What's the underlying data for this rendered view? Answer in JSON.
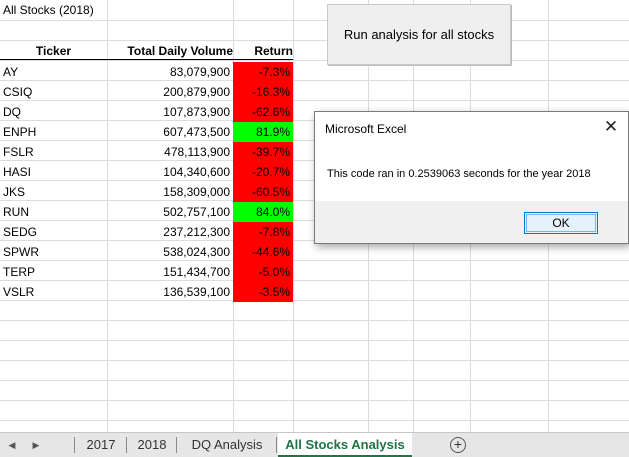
{
  "sheet_title": "All Stocks (2018)",
  "columns": {
    "ticker": "Ticker",
    "volume": "Total Daily Volume",
    "return": "Return"
  },
  "rows": [
    {
      "ticker": "AY",
      "volume": "83,079,900",
      "return": "-7.3%",
      "status": "negative"
    },
    {
      "ticker": "CSIQ",
      "volume": "200,879,900",
      "return": "-16.3%",
      "status": "negative"
    },
    {
      "ticker": "DQ",
      "volume": "107,873,900",
      "return": "-62.6%",
      "status": "negative"
    },
    {
      "ticker": "ENPH",
      "volume": "607,473,500",
      "return": "81.9%",
      "status": "positive"
    },
    {
      "ticker": "FSLR",
      "volume": "478,113,900",
      "return": "-39.7%",
      "status": "negative"
    },
    {
      "ticker": "HASI",
      "volume": "104,340,600",
      "return": "-20.7%",
      "status": "negative"
    },
    {
      "ticker": "JKS",
      "volume": "158,309,000",
      "return": "-60.5%",
      "status": "negative"
    },
    {
      "ticker": "RUN",
      "volume": "502,757,100",
      "return": "84.0%",
      "status": "positive"
    },
    {
      "ticker": "SEDG",
      "volume": "237,212,300",
      "return": "-7.8%",
      "status": "negative"
    },
    {
      "ticker": "SPWR",
      "volume": "538,024,300",
      "return": "-44.6%",
      "status": "negative"
    },
    {
      "ticker": "TERP",
      "volume": "151,434,700",
      "return": "-5.0%",
      "status": "negative"
    },
    {
      "ticker": "VSLR",
      "volume": "136,539,100",
      "return": "-3.5%",
      "status": "negative"
    }
  ],
  "run_button_label": "Run analysis for all stocks",
  "dialog": {
    "title": "Microsoft Excel",
    "message": "This code ran in 0.2539063 seconds for the year 2018",
    "ok_label": "OK",
    "close_glyph": "✕"
  },
  "tabs": [
    {
      "label": "2017",
      "active": false
    },
    {
      "label": "2018",
      "active": false
    },
    {
      "label": "DQ Analysis",
      "active": false
    },
    {
      "label": "All Stocks Analysis",
      "active": true
    }
  ],
  "nav": {
    "prev_glyph": "◀",
    "next_glyph": "▶"
  },
  "add_sheet_glyph": "+",
  "colors": {
    "negative": "#ff0000",
    "positive": "#00ff00",
    "active_tab": "#217346"
  }
}
